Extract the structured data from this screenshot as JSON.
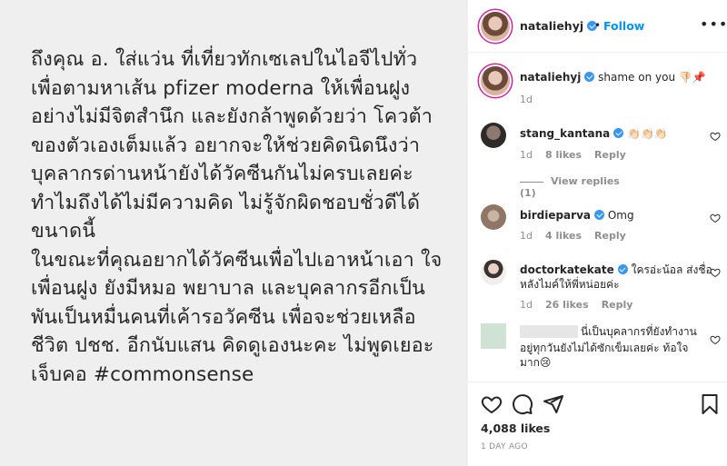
{
  "post": {
    "lines": [
      "ถึงคุณ อ. ใส่แว่น ที่เที่ยวทักเซเลปในไอจีไปทั่ว",
      "เพื่อตามหาเส้น pfizer moderna ให้เพื่อนฝูง",
      "อย่างไม่มีจิตสำนึก และยังกล้าพูดด้วยว่า โควต้า",
      "ของตัวเองเต็มแล้ว  อยากจะให้ช่วยคิดนิดนึงว่า",
      "บุคลากรด่านหน้ายังได้วัคซีนกันไม่ครบเลยค่ะ",
      "ทำไมถึงได้ไม่มีความคิด ไม่รู้จักผิดชอบชั่วดีได้",
      "ขนาดนี้",
      "ในขณะที่คุณอยากได้วัคซีนเพื่อไปเอาหน้าเอา ใจ",
      "เพื่อนฝูง ยังมีหมอ พยาบาล และบุคลากรอีกเป็น",
      "พันเป็นหมื่นคนที่เค้ารอวัคซีน  เพื่อจะช่วยเหลือ",
      "ชีวิต ปชช. อีกนับแสน คิดดูเองนะคะ ไม่พูดเยอะ",
      "เจ็บคอ #commonsense"
    ]
  },
  "header": {
    "username": "nataliehyj",
    "dot": "•",
    "follow_label": "Follow",
    "more_label": "•••"
  },
  "caption": {
    "username": "nataliehyj",
    "text": "shame on you 👎🏻📌",
    "time": "1d"
  },
  "comments": [
    {
      "username": "stang_kantana",
      "text": "👏🏻👏🏻👏🏻",
      "time": "1d",
      "likes": "8 likes",
      "reply": "Reply",
      "view_replies": "View replies (1)"
    },
    {
      "username": "birdieparva",
      "text": "Omg",
      "time": "1d",
      "likes": "4 likes",
      "reply": "Reply"
    },
    {
      "username": "doctorkatekate",
      "text": "ใครอ่ะน้อล ส่งชื่อ",
      "text2": "หลังไมค์ให้พี่หน่อยค่ะ",
      "time": "1d",
      "likes": "26 likes",
      "reply": "Reply"
    },
    {
      "text": "นี่เป็นบุคลากรที่ยังทำงาน",
      "text2": "อยู่ทุกวันยังไม่ได้ซักเข็มเลยค่ะ ท้อใจ",
      "text3": "มาก😢"
    }
  ],
  "footer": {
    "likes": "4,088 likes",
    "date": "1 DAY AGO"
  },
  "colors": {
    "accent": "#0095f6",
    "verified": "#3897f0",
    "muted": "#8e8e8e",
    "text": "#262626"
  }
}
